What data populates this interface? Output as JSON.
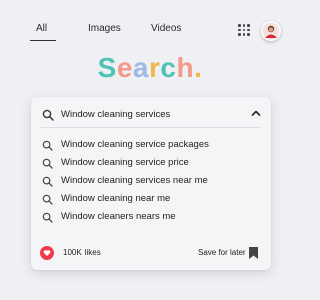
{
  "nav": {
    "tabs": [
      {
        "label": "All",
        "active": true
      },
      {
        "label": "Images",
        "active": false
      },
      {
        "label": "Videos",
        "active": false
      }
    ],
    "apps_icon": "grid-apps-icon",
    "avatar_icon": "user-avatar"
  },
  "logo": {
    "letters": [
      {
        "char": "S",
        "color": "#4fc3b3"
      },
      {
        "char": "e",
        "color": "#f39a8a"
      },
      {
        "char": "a",
        "color": "#9fb8e6"
      },
      {
        "char": "r",
        "color": "#f2b84b"
      },
      {
        "char": "c",
        "color": "#4fc3b3"
      },
      {
        "char": "h",
        "color": "#f39a8a"
      },
      {
        "char": ".",
        "color": "#f2b84b"
      }
    ]
  },
  "search": {
    "value": "Window cleaning services",
    "icon": "search-icon",
    "collapse_icon": "chevron-up-icon"
  },
  "suggestions": [
    "Window cleaning service packages",
    "Window cleaning service price",
    "Window cleaning services near me",
    "Window cleaning near me",
    "Window cleaners nears me"
  ],
  "footer": {
    "likes_count": "100K",
    "likes_label": "likes",
    "save_label": "Save for later",
    "heart_color": "#ef3b4c"
  }
}
